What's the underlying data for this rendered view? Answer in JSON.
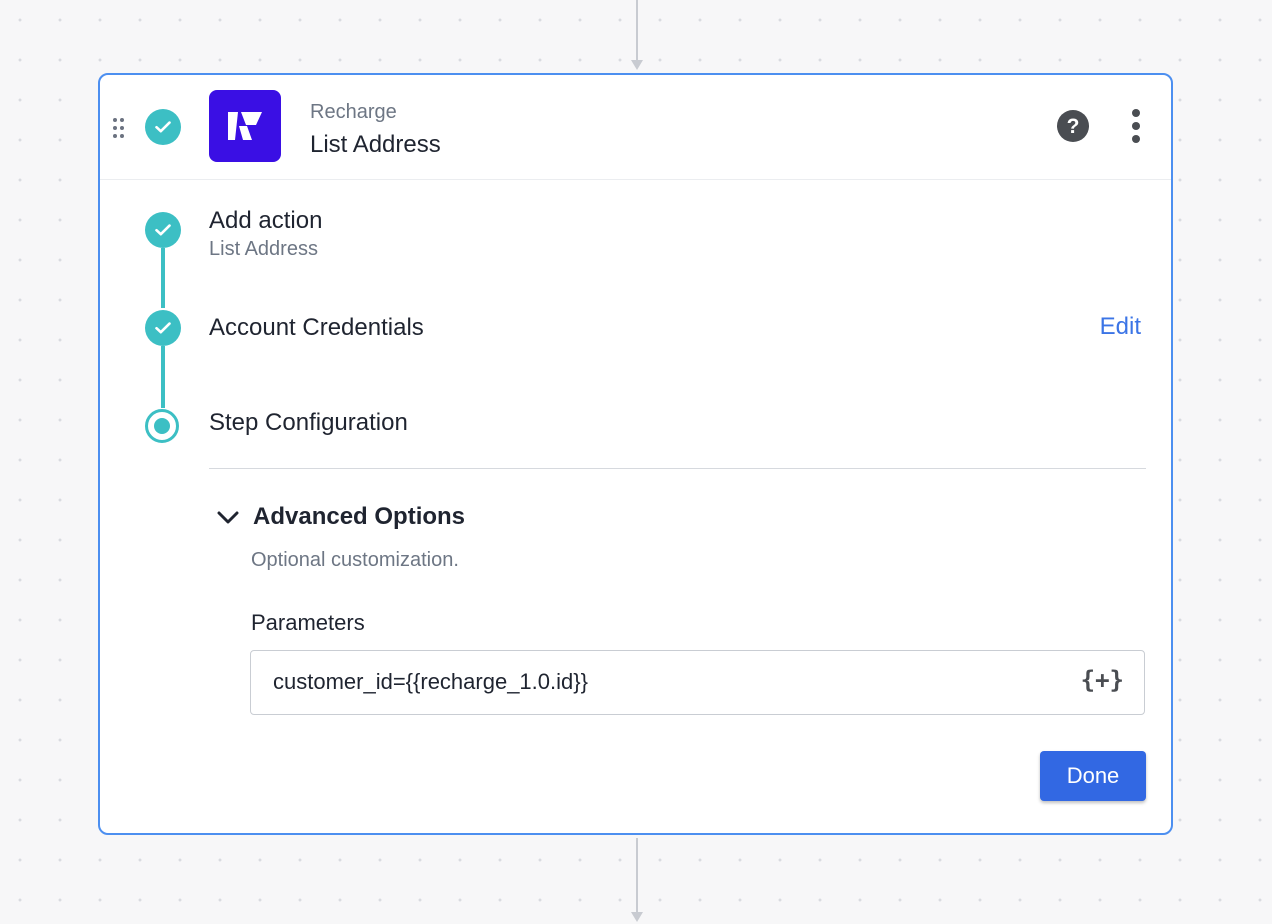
{
  "header": {
    "app_name": "Recharge",
    "action_name": "List Address",
    "logo_icon": "recharge-logo-icon",
    "help_icon": "question-icon",
    "help_glyph": "?",
    "more_icon": "kebab-menu-icon"
  },
  "steps": [
    {
      "title": "Add action",
      "subtitle": "List Address",
      "status": "complete"
    },
    {
      "title": "Account Credentials",
      "status": "complete",
      "action_label": "Edit"
    },
    {
      "title": "Step Configuration",
      "status": "active"
    }
  ],
  "advanced_options": {
    "title": "Advanced Options",
    "description": "Optional customization.",
    "expanded": true,
    "parameters_label": "Parameters",
    "parameters_value": "customer_id={{recharge_1.0.id}}",
    "insert_variable_label": "{+}"
  },
  "done_label": "Done",
  "colors": {
    "accent": "#3cbfc4",
    "card_border": "#4c8ff0",
    "primary_button": "#3268e3",
    "link": "#3b74e6",
    "logo_bg": "#3a0fe4"
  }
}
